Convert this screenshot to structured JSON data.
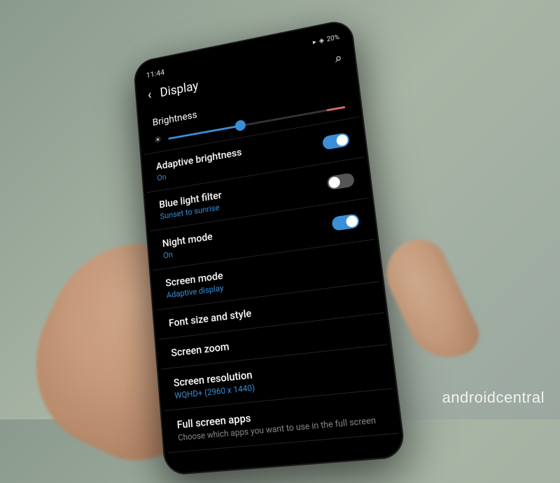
{
  "status_bar": {
    "time": "11:44",
    "battery": "20%",
    "signal_icon": "▸",
    "wifi_icon": "◈"
  },
  "header": {
    "title": "Display",
    "back_icon": "‹",
    "search_icon": "⌕"
  },
  "brightness": {
    "label": "Brightness",
    "sun_icon": "☀",
    "value_percent": 42
  },
  "settings": [
    {
      "title": "Adaptive brightness",
      "subtitle": "On",
      "toggle": "on"
    },
    {
      "title": "Blue light filter",
      "subtitle": "Sunset to sunrise",
      "toggle": "off"
    },
    {
      "title": "Night mode",
      "subtitle": "On",
      "toggle": "on"
    },
    {
      "title": "Screen mode",
      "subtitle": "Adaptive display",
      "toggle": null
    },
    {
      "title": "Font size and style",
      "subtitle": "",
      "toggle": null
    },
    {
      "title": "Screen zoom",
      "subtitle": "",
      "toggle": null
    },
    {
      "title": "Screen resolution",
      "subtitle": "WQHD+ (2960 x 1440)",
      "toggle": null
    },
    {
      "title": "Full screen apps",
      "subtitle": "Choose which apps you want to use in the full screen",
      "toggle": null
    }
  ],
  "watermark": "androidcentral"
}
